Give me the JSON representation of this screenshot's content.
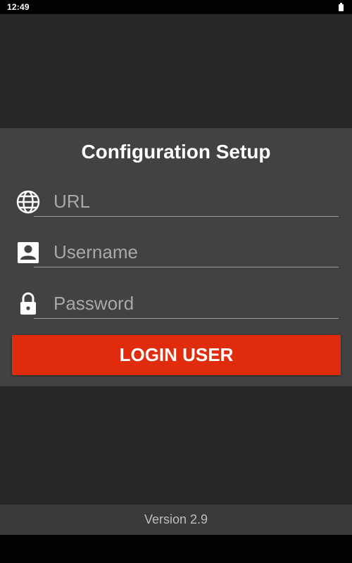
{
  "status_bar": {
    "time": "12:49",
    "battery_icon": "battery-full-icon"
  },
  "login_card": {
    "title": "Configuration Setup",
    "fields": [
      {
        "icon": "globe-icon",
        "placeholder": "URL",
        "value": ""
      },
      {
        "icon": "account-box-icon",
        "placeholder": "Username",
        "value": ""
      },
      {
        "icon": "lock-icon",
        "placeholder": "Password",
        "value": ""
      }
    ],
    "login_button": "LOGIN USER"
  },
  "footer": {
    "version": "Version 2.9"
  },
  "colors": {
    "app_background": "#272727",
    "card_background": "#424242",
    "accent": "#e02b0c",
    "footer_background": "#3a3a3a"
  }
}
